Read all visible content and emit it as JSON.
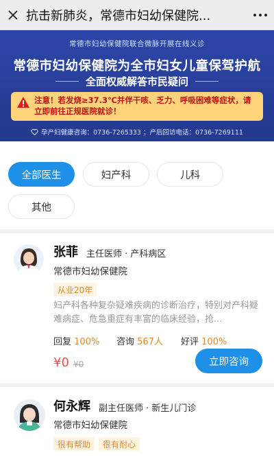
{
  "window": {
    "title": "抗击新肺炎，常德市妇幼保健院..."
  },
  "banner": {
    "subtitle": "常德市妇幼保健院联合微脉开展在线义诊",
    "headline": "常德市妇幼保健院为全市妇女儿童保驾护航",
    "subheadline": "全面权威解答市民疑问",
    "notice": "注意！若发烧≥37.3℃并伴干咳、乏力、呼吸困难等症状，请立即前往正规医院就诊！",
    "footer": "孕产妇健康咨询：0736-7265333 ；产后回访电话：0736-7269111",
    "accent_color": "#2d46a7",
    "notice_bg": "#ffd47a"
  },
  "filters": [
    {
      "label": "全部医生",
      "active": true
    },
    {
      "label": "妇产科",
      "active": false
    },
    {
      "label": "儿科",
      "active": false
    },
    {
      "label": "其他",
      "active": false
    }
  ],
  "doctors": [
    {
      "name": "张菲",
      "title": "主任医师 · 产科病区",
      "hospital": "常德市妇幼保健院",
      "tags": [
        "从业20年"
      ],
      "description": "妇产科各种复杂疑难疾病的诊断治疗，特别对产科疑难病症、危急重症有丰富的临床经验，抢...",
      "reply_label": "回复",
      "reply_value": "100%",
      "consult_label": "咨询",
      "consult_value": "567人",
      "rating_label": "好评",
      "rating_value": "100%",
      "price": "¥0",
      "old_price": "¥0",
      "button": "立即咨询"
    },
    {
      "name": "何永辉",
      "title": "副主任医师 · 新生儿门诊",
      "hospital": "常德市妇幼保健院",
      "tags": [
        "很有帮助",
        "很有耐心"
      ]
    }
  ],
  "colors": {
    "primary": "#1e90e8",
    "orange": "#e0882a",
    "red": "#f04d4d"
  }
}
